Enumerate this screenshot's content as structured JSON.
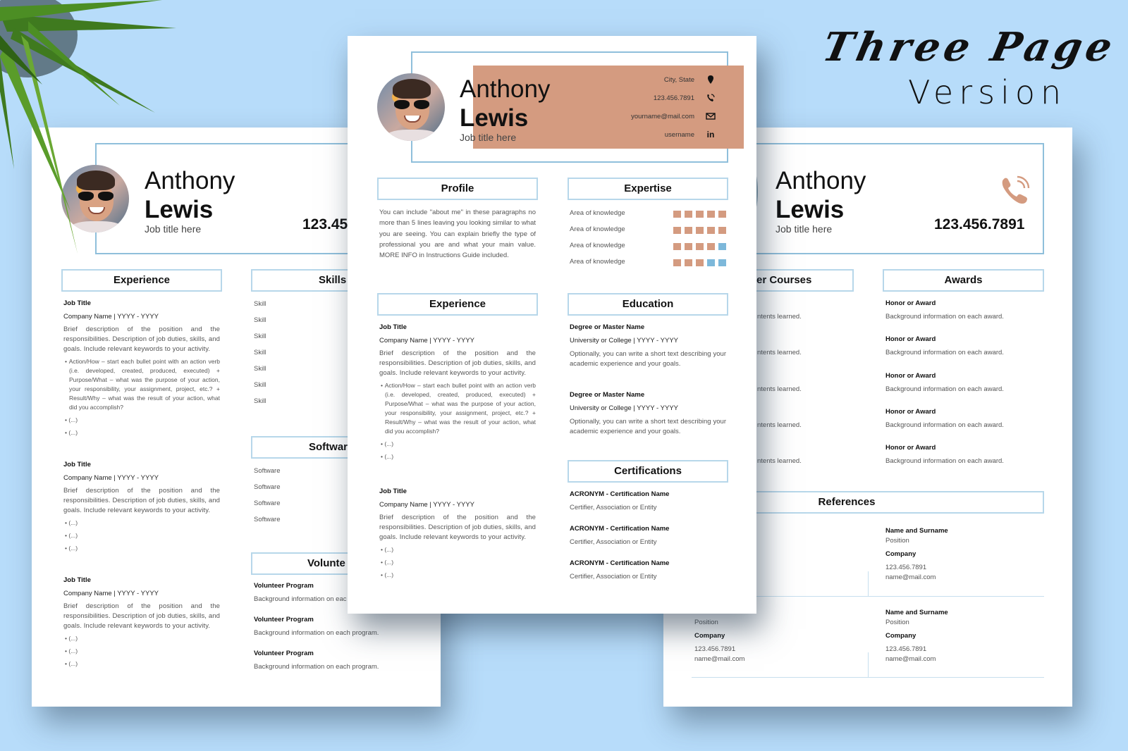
{
  "banner": {
    "line1": "Three Page",
    "line2": "Version"
  },
  "person": {
    "first_name": "Anthony",
    "last_name": "Lewis",
    "job_title": "Job title here"
  },
  "contact": {
    "city": "City, State",
    "phone": "123.456.7891",
    "email": "yourname@mail.com",
    "linkedin": "username",
    "phone_partial": "123.45",
    "icons": [
      "location-pin-icon",
      "phone-icon",
      "envelope-icon",
      "linkedin-icon"
    ]
  },
  "colors": {
    "accent": "#d49b80",
    "frame": "#8fbfdb",
    "section_border": "#b7d7ea",
    "level_off": "#7db8da",
    "background": "#b7dcfa"
  },
  "center": {
    "profile": {
      "heading": "Profile",
      "text": "You can include \"about me\" in these paragraphs no more than 5 lines leaving you looking similar to what you are seeing. You can explain briefly the type of professional you are and what your main value. MORE INFO in Instructions Guide included."
    },
    "expertise": {
      "heading": "Expertise",
      "max_level": 5,
      "items": [
        {
          "label": "Area of knowledge",
          "level": 5
        },
        {
          "label": "Area of knowledge",
          "level": 5
        },
        {
          "label": "Area of knowledge",
          "level": 4
        },
        {
          "label": "Area of knowledge",
          "level": 3
        }
      ]
    },
    "experience": {
      "heading": "Experience",
      "jobs": [
        {
          "title": "Job Title",
          "company": "Company Name | YYYY - YYYY",
          "description": "Brief description of the position and the responsibilities. Description of job duties, skills, and goals. Include relevant keywords to your activity.",
          "bullets": [
            "Action/How – start each bullet point with an action verb (i.e. developed, created, produced, executed) + Purpose/What – what was the purpose of your action, your responsibility, your assignment, project, etc.? + Result/Why – what was the result of your action, what did you accomplish?",
            "(...)",
            "(...)"
          ]
        },
        {
          "title": "Job Title",
          "company": "Company Name | YYYY - YYYY",
          "description": "Brief description of the position and the responsibilities. Description of job duties, skills, and goals. Include relevant keywords to your activity.",
          "bullets": [
            "(...)",
            "(...)",
            "(...)"
          ]
        }
      ]
    },
    "education": {
      "heading": "Education",
      "items": [
        {
          "degree": "Degree or Master Name",
          "school": "University or College | YYYY - YYYY",
          "text": "Optionally, you can write a short text describing your academic experience and your goals."
        },
        {
          "degree": "Degree or Master Name",
          "school": "University or College | YYYY - YYYY",
          "text": "Optionally, you can write a short text describing your academic experience and your goals."
        }
      ]
    },
    "certifications": {
      "heading": "Certifications",
      "items": [
        {
          "name": "ACRONYM - Certification Name",
          "issuer": "Certifier, Association or Entity"
        },
        {
          "name": "ACRONYM - Certification Name",
          "issuer": "Certifier, Association or Entity"
        },
        {
          "name": "ACRONYM - Certification Name",
          "issuer": "Certifier, Association or Entity"
        }
      ]
    }
  },
  "left": {
    "experience": {
      "heading": "Experience",
      "jobs": [
        {
          "title": "Job Title",
          "company": "Company Name | YYYY - YYYY",
          "description": "Brief description of the position and the responsibilities. Description of job duties, skills, and goals. Include relevant keywords to your activity.",
          "bullets": [
            "Action/How – start each bullet point with an action verb (i.e. developed, created, produced, executed) + Purpose/What – what was the purpose of your action, your responsibility, your assignment, project, etc.? + Result/Why – what was the result of your action, what did you accomplish?",
            "(...)",
            "(...)"
          ]
        },
        {
          "title": "Job Title",
          "company": "Company Name | YYYY - YYYY",
          "description": "Brief description of the position and the responsibilities. Description of job duties, skills, and goals. Include relevant keywords to your activity.",
          "bullets": [
            "(...)",
            "(...)",
            "(...)"
          ]
        },
        {
          "title": "Job Title",
          "company": "Company Name | YYYY - YYYY",
          "description": "Brief description of the position and the responsibilities. Description of job duties, skills, and goals. Include relevant keywords to your activity.",
          "bullets": [
            "(...)",
            "(...)",
            "(...)"
          ]
        }
      ]
    },
    "skills": {
      "heading": "Skills",
      "items": [
        "Skill",
        "Skill",
        "Skill",
        "Skill",
        "Skill",
        "Skill",
        "Skill"
      ]
    },
    "software": {
      "heading": "Softwar",
      "items": [
        "Software",
        "Software",
        "Software",
        "Software"
      ]
    },
    "volunteer": {
      "heading": "Volunte",
      "items": [
        {
          "title": "Volunteer Program",
          "text": "Background information on eac"
        },
        {
          "title": "Volunteer Program",
          "text": "Background information on each program."
        },
        {
          "title": "Volunteer Program",
          "text": "Background information on each program."
        }
      ]
    }
  },
  "right": {
    "courses": {
      "heading": "er Courses",
      "items": [
        "ntents learned.",
        "ntents learned.",
        "ntents learned.",
        "ntents learned.",
        "ntents learned."
      ]
    },
    "awards": {
      "heading": "Awards",
      "items": [
        {
          "title": "Honor or Award",
          "text": "Background information on each award."
        },
        {
          "title": "Honor or Award",
          "text": "Background information on each award."
        },
        {
          "title": "Honor or Award",
          "text": "Background information on each award."
        },
        {
          "title": "Honor or Award",
          "text": "Background information on each award."
        },
        {
          "title": "Honor or Award",
          "text": "Background information on each award."
        }
      ]
    },
    "references": {
      "heading": "References",
      "items": [
        {
          "name": "Name and Surname",
          "position": "Position",
          "company": "Company",
          "phone": "123.456.7891",
          "email": "name@mail.com"
        },
        {
          "name": "",
          "position": "Position",
          "company": "Company",
          "phone": "123.456.7891",
          "email": "name@mail.com"
        },
        {
          "name": "Name and Surname",
          "position": "Position",
          "company": "Company",
          "phone": "123.456.7891",
          "email": "name@mail.com"
        }
      ]
    }
  }
}
